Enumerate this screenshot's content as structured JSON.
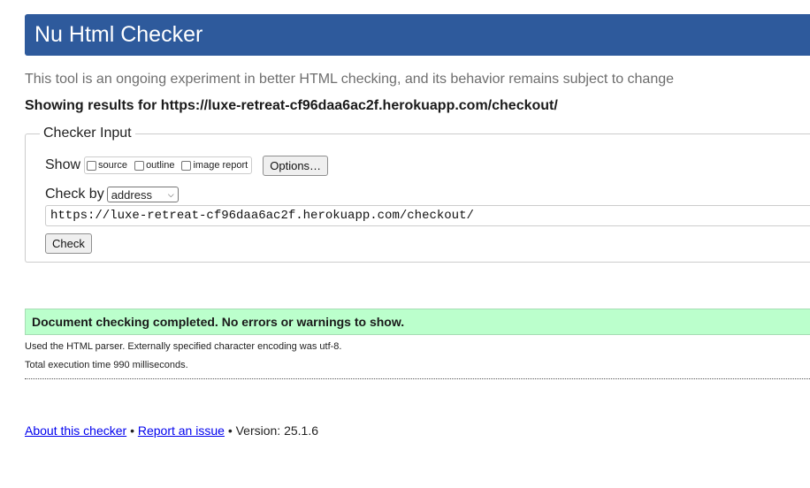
{
  "header": {
    "title": "Nu Html Checker",
    "color": "#2e5a9c"
  },
  "tagline": "This tool is an ongoing experiment in better HTML checking, and its behavior remains subject to change",
  "showing_results": "Showing results for https://luxe-retreat-cf96daa6ac2f.herokuapp.com/checkout/",
  "checker_input": {
    "legend": "Checker Input",
    "show_label": "Show",
    "show_options": [
      {
        "label": "source",
        "checked": false
      },
      {
        "label": "outline",
        "checked": false
      },
      {
        "label": "image report",
        "checked": false
      }
    ],
    "options_button": "Options…",
    "check_by_label": "Check by",
    "check_by_selected": "address",
    "url_value": "https://luxe-retreat-cf96daa6ac2f.herokuapp.com/checkout/",
    "check_button": "Check"
  },
  "result": {
    "message": "Document checking completed. No errors or warnings to show.",
    "color": "#bbffcc",
    "parser_info": "Used the HTML parser. Externally specified character encoding was utf-8.",
    "execution_time": "Total execution time 990 milliseconds."
  },
  "footer": {
    "about_link": "About this checker",
    "separator": "•",
    "report_link": "Report an issue",
    "version": "Version: 25.1.6"
  }
}
